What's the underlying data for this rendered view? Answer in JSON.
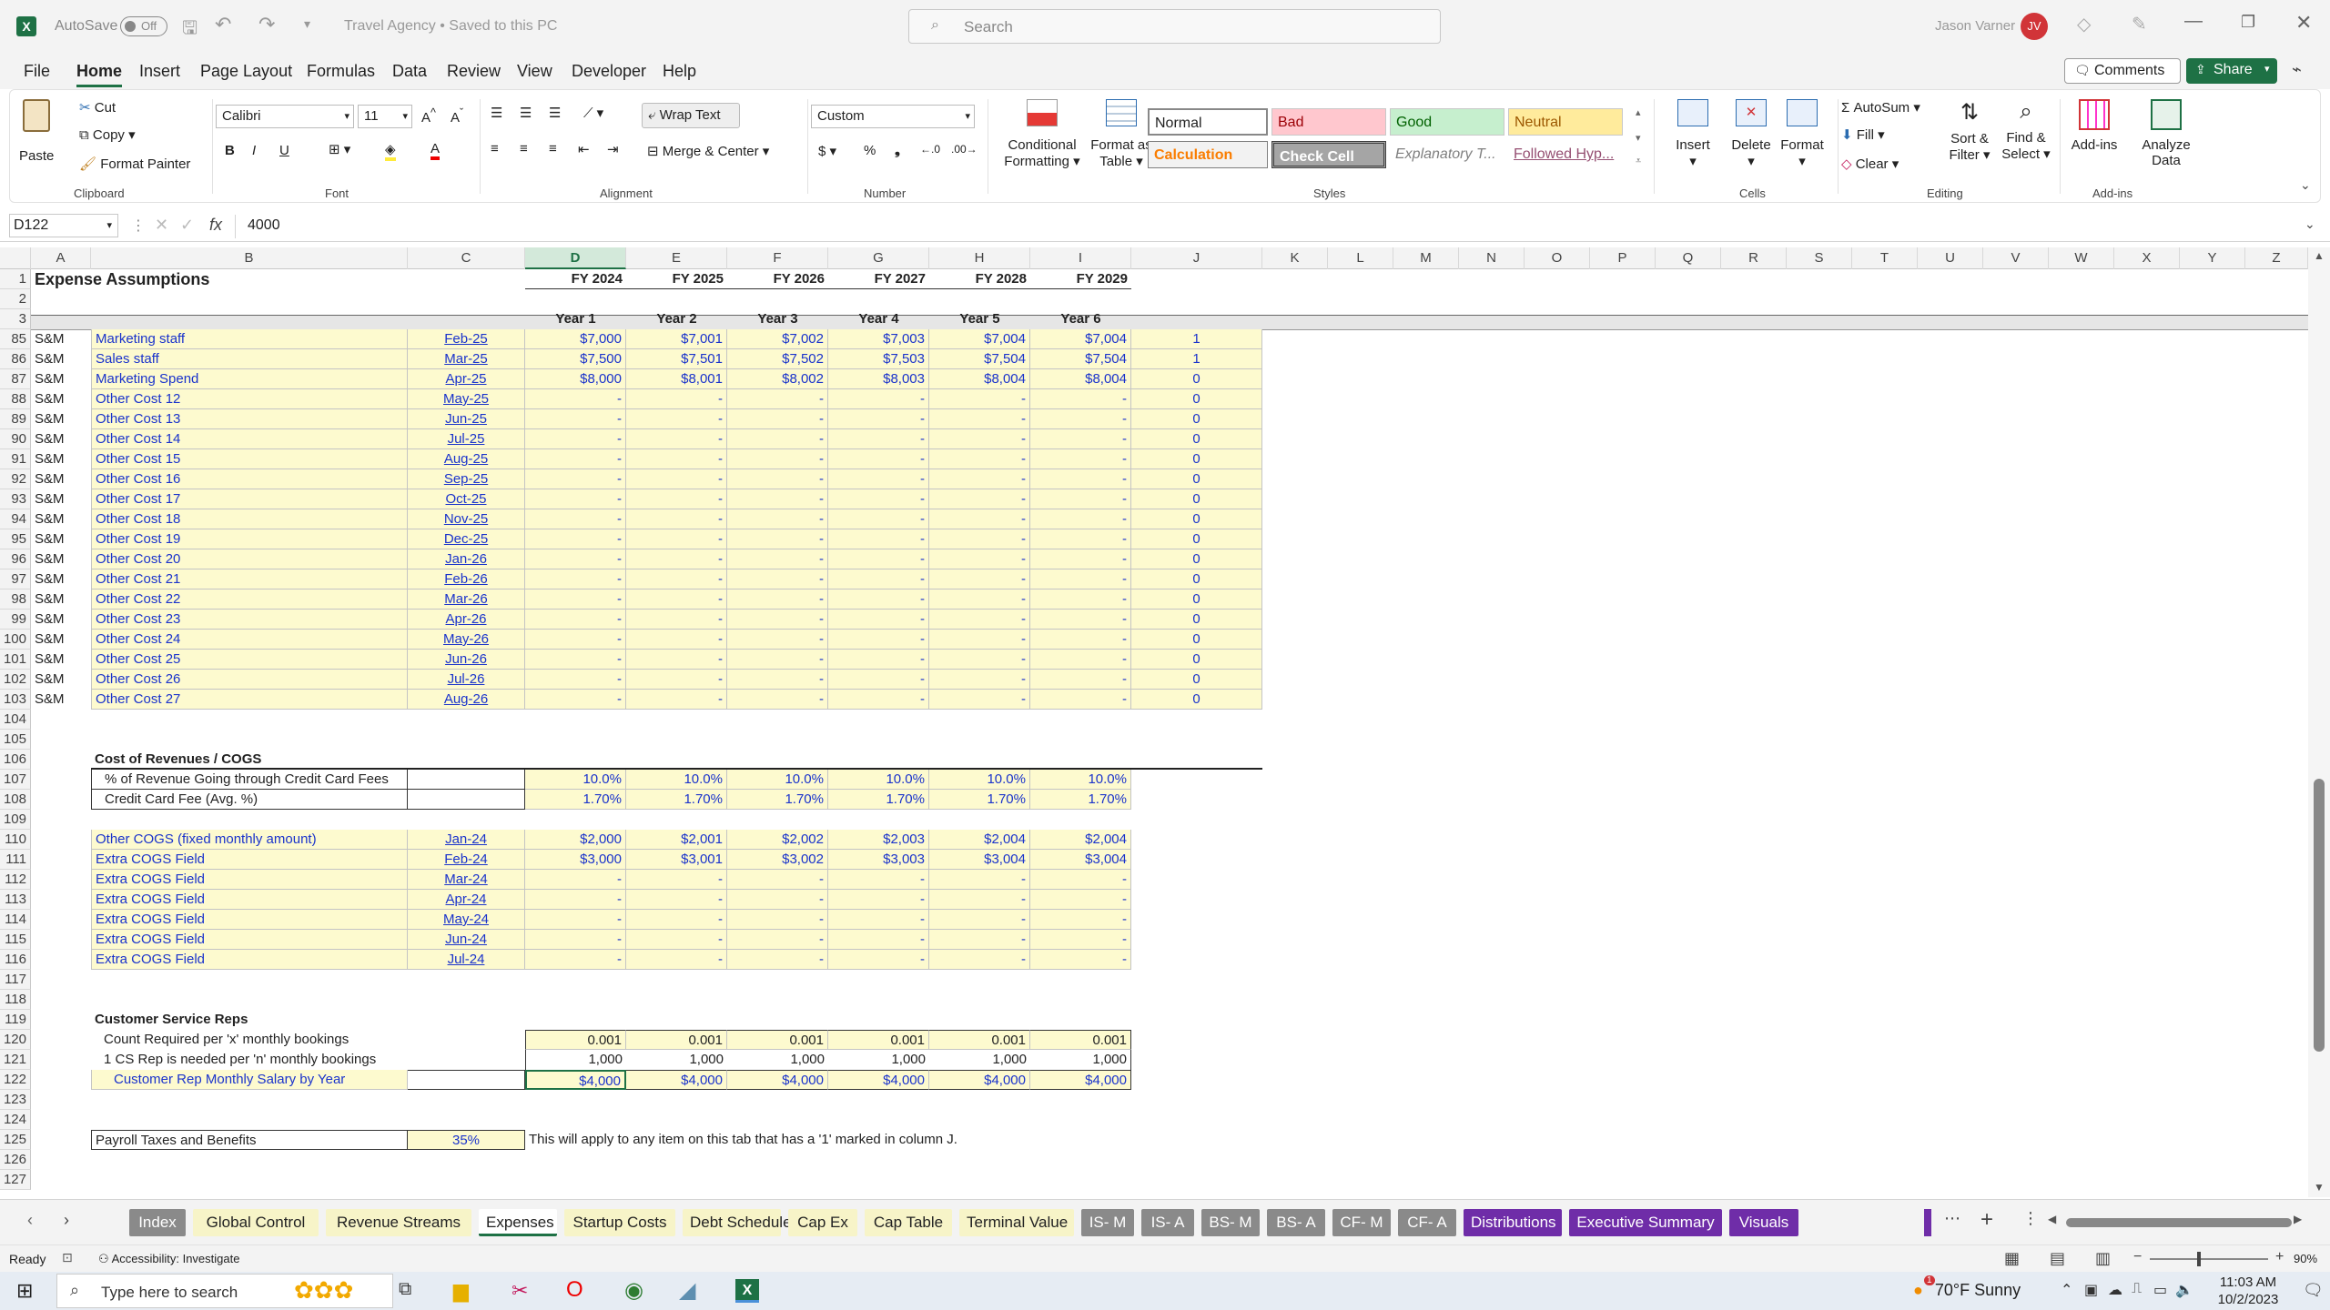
{
  "titlebar": {
    "autosave": "AutoSave",
    "autosave_state": "Off",
    "doc_title": "Travel Agency • Saved to this PC",
    "search_placeholder": "Search",
    "user_name": "Jason Varner",
    "user_initials": "JV"
  },
  "menu": [
    "File",
    "Home",
    "Insert",
    "Page Layout",
    "Formulas",
    "Data",
    "Review",
    "View",
    "Developer",
    "Help"
  ],
  "menu_right": {
    "comments": "Comments",
    "share": "Share"
  },
  "ribbon": {
    "clipboard": {
      "paste": "Paste",
      "cut": "Cut",
      "copy": "Copy",
      "format_painter": "Format Painter",
      "label": "Clipboard"
    },
    "font": {
      "name": "Calibri",
      "size": "11",
      "label": "Font"
    },
    "alignment": {
      "wrap": "Wrap Text",
      "merge": "Merge & Center",
      "label": "Alignment"
    },
    "number": {
      "format": "Custom",
      "label": "Number"
    },
    "styles": {
      "cond": "Conditional",
      "cond2": "Formatting",
      "fmt_table": "Format as",
      "fmt_table2": "Table",
      "normal": "Normal",
      "bad": "Bad",
      "good": "Good",
      "neutral": "Neutral",
      "calculation": "Calculation",
      "check": "Check Cell",
      "explanatory": "Explanatory T...",
      "followed": "Followed Hyp...",
      "label": "Styles"
    },
    "cells": {
      "insert": "Insert",
      "delete": "Delete",
      "format": "Format",
      "label": "Cells"
    },
    "editing": {
      "autosum": "AutoSum",
      "fill": "Fill",
      "clear": "Clear",
      "sort": "Sort &",
      "sort2": "Filter",
      "find": "Find &",
      "find2": "Select",
      "label": "Editing"
    },
    "addins": {
      "addins": "Add-ins",
      "analyze": "Analyze",
      "analyze2": "Data",
      "label": "Add-ins"
    }
  },
  "formula_bar": {
    "namebox": "D122",
    "fx": "fx",
    "value": "4000"
  },
  "columns": [
    "A",
    "B",
    "C",
    "D",
    "E",
    "F",
    "G",
    "H",
    "I",
    "J",
    "K",
    "L",
    "M",
    "N",
    "O",
    "P",
    "Q",
    "R",
    "S",
    "T",
    "U",
    "V",
    "W",
    "X",
    "Y",
    "Z"
  ],
  "header": {
    "title": "Expense Assumptions",
    "fy": [
      "FY 2024",
      "FY 2025",
      "FY 2026",
      "FY 2027",
      "FY 2028",
      "FY 2029"
    ],
    "years": [
      "Year 1",
      "Year 2",
      "Year 3",
      "Year 4",
      "Year 5",
      "Year 6"
    ]
  },
  "sm_rows": [
    {
      "n": "85",
      "a": "S&M",
      "b": "Marketing staff",
      "c": "Feb-25",
      "v": [
        "$7,000",
        "$7,001",
        "$7,002",
        "$7,003",
        "$7,004",
        "$7,004"
      ],
      "j": "1"
    },
    {
      "n": "86",
      "a": "S&M",
      "b": "Sales staff",
      "c": "Mar-25",
      "v": [
        "$7,500",
        "$7,501",
        "$7,502",
        "$7,503",
        "$7,504",
        "$7,504"
      ],
      "j": "1"
    },
    {
      "n": "87",
      "a": "S&M",
      "b": "Marketing Spend",
      "c": "Apr-25",
      "v": [
        "$8,000",
        "$8,001",
        "$8,002",
        "$8,003",
        "$8,004",
        "$8,004"
      ],
      "j": "0"
    },
    {
      "n": "88",
      "a": "S&M",
      "b": "Other Cost 12",
      "c": "May-25",
      "v": [
        "-",
        "-",
        "-",
        "-",
        "-",
        "-"
      ],
      "j": "0"
    },
    {
      "n": "89",
      "a": "S&M",
      "b": "Other Cost 13",
      "c": "Jun-25",
      "v": [
        "-",
        "-",
        "-",
        "-",
        "-",
        "-"
      ],
      "j": "0"
    },
    {
      "n": "90",
      "a": "S&M",
      "b": "Other Cost 14",
      "c": "Jul-25",
      "v": [
        "-",
        "-",
        "-",
        "-",
        "-",
        "-"
      ],
      "j": "0"
    },
    {
      "n": "91",
      "a": "S&M",
      "b": "Other Cost 15",
      "c": "Aug-25",
      "v": [
        "-",
        "-",
        "-",
        "-",
        "-",
        "-"
      ],
      "j": "0"
    },
    {
      "n": "92",
      "a": "S&M",
      "b": "Other Cost 16",
      "c": "Sep-25",
      "v": [
        "-",
        "-",
        "-",
        "-",
        "-",
        "-"
      ],
      "j": "0"
    },
    {
      "n": "93",
      "a": "S&M",
      "b": "Other Cost 17",
      "c": "Oct-25",
      "v": [
        "-",
        "-",
        "-",
        "-",
        "-",
        "-"
      ],
      "j": "0"
    },
    {
      "n": "94",
      "a": "S&M",
      "b": "Other Cost 18",
      "c": "Nov-25",
      "v": [
        "-",
        "-",
        "-",
        "-",
        "-",
        "-"
      ],
      "j": "0"
    },
    {
      "n": "95",
      "a": "S&M",
      "b": "Other Cost 19",
      "c": "Dec-25",
      "v": [
        "-",
        "-",
        "-",
        "-",
        "-",
        "-"
      ],
      "j": "0"
    },
    {
      "n": "96",
      "a": "S&M",
      "b": "Other Cost 20",
      "c": "Jan-26",
      "v": [
        "-",
        "-",
        "-",
        "-",
        "-",
        "-"
      ],
      "j": "0"
    },
    {
      "n": "97",
      "a": "S&M",
      "b": "Other Cost 21",
      "c": "Feb-26",
      "v": [
        "-",
        "-",
        "-",
        "-",
        "-",
        "-"
      ],
      "j": "0"
    },
    {
      "n": "98",
      "a": "S&M",
      "b": "Other Cost 22",
      "c": "Mar-26",
      "v": [
        "-",
        "-",
        "-",
        "-",
        "-",
        "-"
      ],
      "j": "0"
    },
    {
      "n": "99",
      "a": "S&M",
      "b": "Other Cost 23",
      "c": "Apr-26",
      "v": [
        "-",
        "-",
        "-",
        "-",
        "-",
        "-"
      ],
      "j": "0"
    },
    {
      "n": "100",
      "a": "S&M",
      "b": "Other Cost 24",
      "c": "May-26",
      "v": [
        "-",
        "-",
        "-",
        "-",
        "-",
        "-"
      ],
      "j": "0"
    },
    {
      "n": "101",
      "a": "S&M",
      "b": "Other Cost 25",
      "c": "Jun-26",
      "v": [
        "-",
        "-",
        "-",
        "-",
        "-",
        "-"
      ],
      "j": "0"
    },
    {
      "n": "102",
      "a": "S&M",
      "b": "Other Cost 26",
      "c": "Jul-26",
      "v": [
        "-",
        "-",
        "-",
        "-",
        "-",
        "-"
      ],
      "j": "0"
    },
    {
      "n": "103",
      "a": "S&M",
      "b": "Other Cost 27",
      "c": "Aug-26",
      "v": [
        "-",
        "-",
        "-",
        "-",
        "-",
        "-"
      ],
      "j": "0"
    }
  ],
  "cogs": {
    "title": "Cost of Revenues / COGS",
    "pct_label": "% of Revenue Going through Credit Card Fees",
    "pct": [
      "10.0%",
      "10.0%",
      "10.0%",
      "10.0%",
      "10.0%",
      "10.0%"
    ],
    "fee_label": "Credit Card Fee (Avg. %)",
    "fee": [
      "1.70%",
      "1.70%",
      "1.70%",
      "1.70%",
      "1.70%",
      "1.70%"
    ],
    "rows": [
      {
        "n": "110",
        "b": "Other COGS (fixed monthly amount)",
        "c": "Jan-24",
        "v": [
          "$2,000",
          "$2,001",
          "$2,002",
          "$2,003",
          "$2,004",
          "$2,004"
        ]
      },
      {
        "n": "111",
        "b": "Extra COGS Field",
        "c": "Feb-24",
        "v": [
          "$3,000",
          "$3,001",
          "$3,002",
          "$3,003",
          "$3,004",
          "$3,004"
        ]
      },
      {
        "n": "112",
        "b": "Extra COGS Field",
        "c": "Mar-24",
        "v": [
          "-",
          "-",
          "-",
          "-",
          "-",
          "-"
        ]
      },
      {
        "n": "113",
        "b": "Extra COGS Field",
        "c": "Apr-24",
        "v": [
          "-",
          "-",
          "-",
          "-",
          "-",
          "-"
        ]
      },
      {
        "n": "114",
        "b": "Extra COGS Field",
        "c": "May-24",
        "v": [
          "-",
          "-",
          "-",
          "-",
          "-",
          "-"
        ]
      },
      {
        "n": "115",
        "b": "Extra COGS Field",
        "c": "Jun-24",
        "v": [
          "-",
          "-",
          "-",
          "-",
          "-",
          "-"
        ]
      },
      {
        "n": "116",
        "b": "Extra COGS Field",
        "c": "Jul-24",
        "v": [
          "-",
          "-",
          "-",
          "-",
          "-",
          "-"
        ]
      }
    ]
  },
  "csr": {
    "title": "Customer Service Reps",
    "count_label": "Count Required per 'x' monthly bookings",
    "count": [
      "0.001",
      "0.001",
      "0.001",
      "0.001",
      "0.001",
      "0.001"
    ],
    "rep_label": "1 CS Rep is needed per 'n' monthly bookings",
    "rep": [
      "1,000",
      "1,000",
      "1,000",
      "1,000",
      "1,000",
      "1,000"
    ],
    "sal_label": "Customer Rep Monthly Salary by Year",
    "sal": [
      "$4,000",
      "$4,000",
      "$4,000",
      "$4,000",
      "$4,000",
      "$4,000"
    ]
  },
  "payroll": {
    "label": "Payroll Taxes and Benefits",
    "value": "35%",
    "note": "This will apply to any item on this tab that has a '1' marked in column J."
  },
  "tabs": [
    {
      "label": "Index",
      "style": "g"
    },
    {
      "label": "Global Control",
      "style": "y2"
    },
    {
      "label": "Revenue Streams",
      "style": "y2"
    },
    {
      "label": "Expenses",
      "style": "act"
    },
    {
      "label": "Startup Costs",
      "style": "y2"
    },
    {
      "label": "Debt Schedule",
      "style": "y2"
    },
    {
      "label": "Cap Ex",
      "style": "y2"
    },
    {
      "label": "Cap Table",
      "style": "y2"
    },
    {
      "label": "Terminal Value",
      "style": "y2"
    },
    {
      "label": "IS- M",
      "style": "g"
    },
    {
      "label": "IS- A",
      "style": "g"
    },
    {
      "label": "BS- M",
      "style": "g"
    },
    {
      "label": "BS- A",
      "style": "g"
    },
    {
      "label": "CF- M",
      "style": "g"
    },
    {
      "label": "CF- A",
      "style": "g"
    },
    {
      "label": "Distributions",
      "style": "p"
    },
    {
      "label": "Executive Summary",
      "style": "p"
    },
    {
      "label": "Visuals",
      "style": "p"
    }
  ],
  "status": {
    "ready": "Ready",
    "accessibility": "Accessibility: Investigate",
    "zoom": "90%"
  },
  "taskbar": {
    "search": "Type here to search",
    "weather": "70°F  Sunny",
    "time": "11:03 AM",
    "date": "10/2/2023",
    "badge": "1"
  },
  "colors": {
    "accent": "#1e7145",
    "input_fill": "#fdfacf",
    "link_blue": "#1a33cc",
    "purple_tab": "#6f2da8",
    "gray_tab": "#8a8a8a"
  }
}
